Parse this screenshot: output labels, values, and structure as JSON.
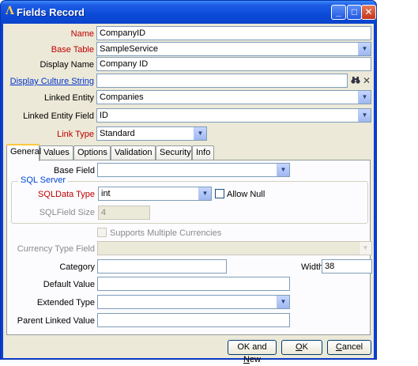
{
  "window": {
    "title": "Fields Record"
  },
  "form": {
    "name": {
      "label": "Name",
      "value": "CompanyID"
    },
    "base_table": {
      "label": "Base Table",
      "value": "SampleService"
    },
    "display_name": {
      "label": "Display Name",
      "value": "Company ID"
    },
    "display_culture_string": {
      "label": "Display Culture String",
      "value": ""
    },
    "linked_entity": {
      "label": "Linked Entity",
      "value": "Companies"
    },
    "linked_entity_field": {
      "label": "Linked Entity Field",
      "value": "ID"
    },
    "link_type": {
      "label": "Link Type",
      "value": "Standard"
    }
  },
  "tabs": [
    "General",
    "Values",
    "Options",
    "Validation",
    "Security",
    "Info"
  ],
  "general": {
    "base_field": {
      "label": "Base Field",
      "value": ""
    },
    "sql_server": {
      "title": "SQL Server",
      "sql_data_type": {
        "label": "SQLData Type",
        "value": "int"
      },
      "allow_null": {
        "label": "Allow Null",
        "checked": false
      },
      "sql_field_size": {
        "label": "SQLField Size",
        "value": "4"
      }
    },
    "supports_multiple_currencies": {
      "label": "Supports Multiple Currencies",
      "checked": false
    },
    "currency_type_field": {
      "label": "Currency Type Field",
      "value": ""
    },
    "category": {
      "label": "Category",
      "value": ""
    },
    "width": {
      "label": "Width",
      "value": "38"
    },
    "default_value": {
      "label": "Default Value",
      "value": ""
    },
    "extended_type": {
      "label": "Extended Type",
      "value": ""
    },
    "parent_linked_value": {
      "label": "Parent Linked Value",
      "value": ""
    }
  },
  "buttons": {
    "ok_and_new": {
      "pre": "OK and ",
      "key": "N",
      "post": "ew"
    },
    "ok": {
      "pre": "",
      "key": "O",
      "post": "K"
    },
    "cancel": {
      "pre": "",
      "key": "C",
      "post": "ancel"
    }
  },
  "icons": {
    "title": "app-logo",
    "search": "binoculars-icon",
    "clear": "clear-x-icon"
  },
  "colors": {
    "title_bar": "#0b4ad8",
    "required_label": "#c00000",
    "link_label": "#0033cc",
    "group_title": "#0046d5",
    "active_tab_accent": "#ffc83c"
  }
}
